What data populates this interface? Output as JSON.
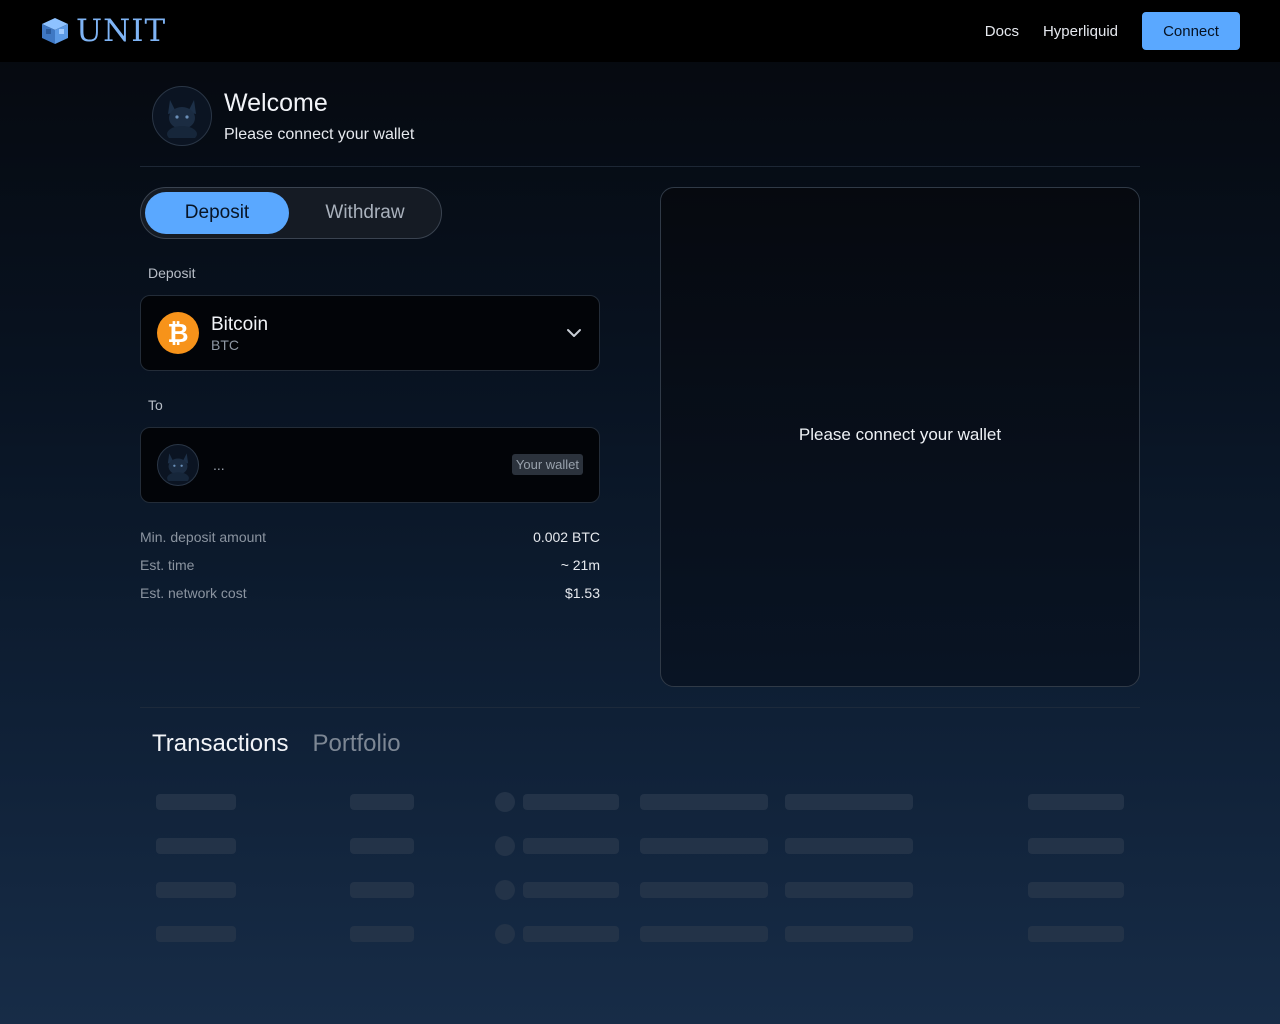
{
  "navbar": {
    "brand": "UNIT",
    "links": [
      "Docs",
      "Hyperliquid"
    ],
    "connect_label": "Connect"
  },
  "welcome": {
    "title": "Welcome",
    "subtitle": "Please connect your wallet"
  },
  "toggle": {
    "tabs": [
      {
        "label": "Deposit",
        "active": true
      },
      {
        "label": "Withdraw",
        "active": false
      }
    ]
  },
  "deposit": {
    "label": "Deposit",
    "asset": {
      "name": "Bitcoin",
      "symbol": "BTC",
      "icon": "bitcoin-icon",
      "color": "#f7931a"
    }
  },
  "to": {
    "label": "To",
    "address": "...",
    "badge": "Your wallet"
  },
  "info": [
    {
      "label": "Min. deposit amount",
      "value": "0.002 BTC"
    },
    {
      "label": "Est. time",
      "value": "~ 21m"
    },
    {
      "label": "Est. network cost",
      "value": "$1.53"
    }
  ],
  "right_panel": {
    "message": "Please connect your wallet"
  },
  "bottom_tabs": [
    {
      "label": "Transactions",
      "active": true
    },
    {
      "label": "Portfolio",
      "active": false
    }
  ],
  "colors": {
    "accent": "#5aa8ff",
    "bitcoin": "#f7931a",
    "brand": "#7fb4f5"
  }
}
